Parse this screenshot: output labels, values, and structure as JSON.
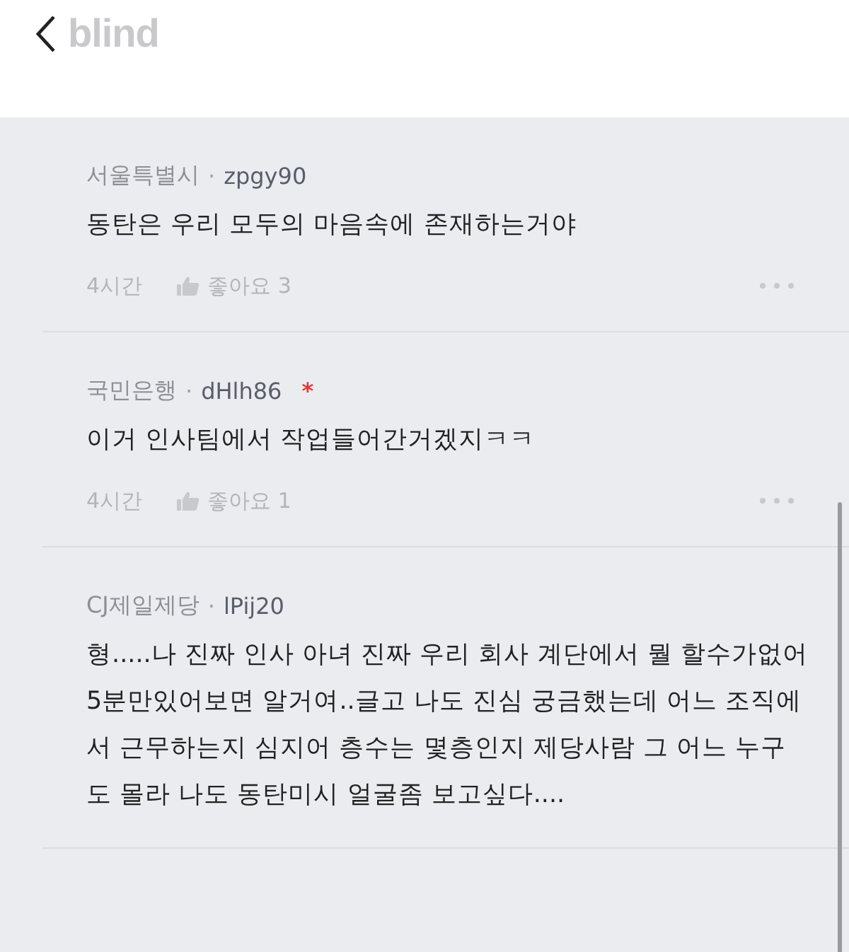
{
  "header": {
    "logo": "blind"
  },
  "comments": [
    {
      "company": "서울특별시",
      "separator": "·",
      "user": "zpgy90",
      "text": "동탄은 우리 모두의 마음속에 존재하는거야",
      "time": "4시간",
      "likes": "좋아요 3"
    },
    {
      "company": "국민은행",
      "separator": "·",
      "user": "dHlh86",
      "badge": "*",
      "text": "이거 인사팀에서 작업들어간거겠지ㅋㅋ",
      "time": "4시간",
      "likes": "좋아요 1"
    },
    {
      "company": "CJ제일제당",
      "separator": "·",
      "user": "lPij20",
      "text": "형.....나 진짜 인사 아녀 진짜 우리 회사 계단에서 뭘 할수가없어 5분만있어보면 알거여..글고 나도 진심 궁금했는데 어느 조직에서 근무하는지 심지어 층수는 몇층인지 제당사람 그 어느 누구도 몰라 나도 동탄미시 얼굴좀 보고싶다...."
    }
  ]
}
